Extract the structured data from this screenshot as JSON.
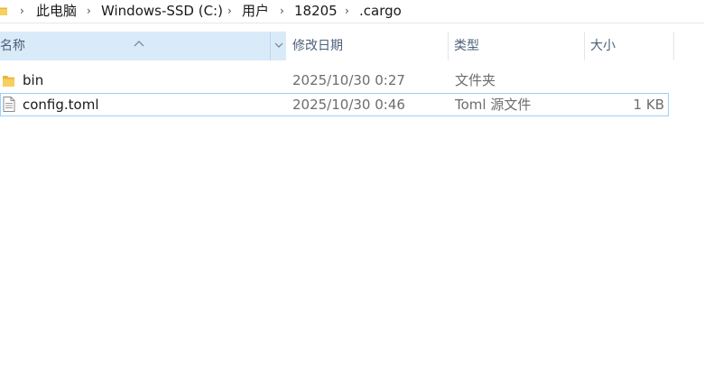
{
  "breadcrumb": {
    "items": [
      "此电脑",
      "Windows-SSD (C:)",
      "用户",
      "18205",
      ".cargo"
    ],
    "separator": "›"
  },
  "columns": {
    "name": "名称",
    "modified": "修改日期",
    "type": "类型",
    "size": "大小"
  },
  "files": [
    {
      "name": "bin",
      "modified": "2025/10/30 0:27",
      "type": "文件夹",
      "size": "",
      "icon": "folder-icon"
    },
    {
      "name": "config.toml",
      "modified": "2025/10/30 0:46",
      "type": "Toml 源文件",
      "size": "1 KB",
      "icon": "file-icon"
    }
  ],
  "colors": {
    "header_highlight": "#d9ebf9",
    "selection_border": "#99d1ff",
    "folder_yellow": "#f4c542"
  }
}
